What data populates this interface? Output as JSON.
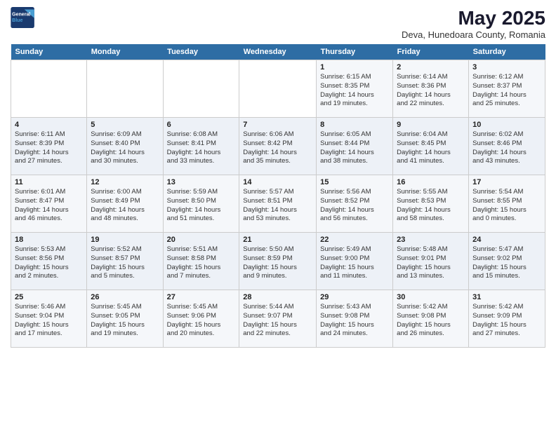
{
  "header": {
    "logo_line1": "General",
    "logo_line2": "Blue",
    "month": "May 2025",
    "location": "Deva, Hunedoara County, Romania"
  },
  "weekdays": [
    "Sunday",
    "Monday",
    "Tuesday",
    "Wednesday",
    "Thursday",
    "Friday",
    "Saturday"
  ],
  "weeks": [
    [
      {
        "day": "",
        "info": ""
      },
      {
        "day": "",
        "info": ""
      },
      {
        "day": "",
        "info": ""
      },
      {
        "day": "",
        "info": ""
      },
      {
        "day": "1",
        "info": "Sunrise: 6:15 AM\nSunset: 8:35 PM\nDaylight: 14 hours\nand 19 minutes."
      },
      {
        "day": "2",
        "info": "Sunrise: 6:14 AM\nSunset: 8:36 PM\nDaylight: 14 hours\nand 22 minutes."
      },
      {
        "day": "3",
        "info": "Sunrise: 6:12 AM\nSunset: 8:37 PM\nDaylight: 14 hours\nand 25 minutes."
      }
    ],
    [
      {
        "day": "4",
        "info": "Sunrise: 6:11 AM\nSunset: 8:39 PM\nDaylight: 14 hours\nand 27 minutes."
      },
      {
        "day": "5",
        "info": "Sunrise: 6:09 AM\nSunset: 8:40 PM\nDaylight: 14 hours\nand 30 minutes."
      },
      {
        "day": "6",
        "info": "Sunrise: 6:08 AM\nSunset: 8:41 PM\nDaylight: 14 hours\nand 33 minutes."
      },
      {
        "day": "7",
        "info": "Sunrise: 6:06 AM\nSunset: 8:42 PM\nDaylight: 14 hours\nand 35 minutes."
      },
      {
        "day": "8",
        "info": "Sunrise: 6:05 AM\nSunset: 8:44 PM\nDaylight: 14 hours\nand 38 minutes."
      },
      {
        "day": "9",
        "info": "Sunrise: 6:04 AM\nSunset: 8:45 PM\nDaylight: 14 hours\nand 41 minutes."
      },
      {
        "day": "10",
        "info": "Sunrise: 6:02 AM\nSunset: 8:46 PM\nDaylight: 14 hours\nand 43 minutes."
      }
    ],
    [
      {
        "day": "11",
        "info": "Sunrise: 6:01 AM\nSunset: 8:47 PM\nDaylight: 14 hours\nand 46 minutes."
      },
      {
        "day": "12",
        "info": "Sunrise: 6:00 AM\nSunset: 8:49 PM\nDaylight: 14 hours\nand 48 minutes."
      },
      {
        "day": "13",
        "info": "Sunrise: 5:59 AM\nSunset: 8:50 PM\nDaylight: 14 hours\nand 51 minutes."
      },
      {
        "day": "14",
        "info": "Sunrise: 5:57 AM\nSunset: 8:51 PM\nDaylight: 14 hours\nand 53 minutes."
      },
      {
        "day": "15",
        "info": "Sunrise: 5:56 AM\nSunset: 8:52 PM\nDaylight: 14 hours\nand 56 minutes."
      },
      {
        "day": "16",
        "info": "Sunrise: 5:55 AM\nSunset: 8:53 PM\nDaylight: 14 hours\nand 58 minutes."
      },
      {
        "day": "17",
        "info": "Sunrise: 5:54 AM\nSunset: 8:55 PM\nDaylight: 15 hours\nand 0 minutes."
      }
    ],
    [
      {
        "day": "18",
        "info": "Sunrise: 5:53 AM\nSunset: 8:56 PM\nDaylight: 15 hours\nand 2 minutes."
      },
      {
        "day": "19",
        "info": "Sunrise: 5:52 AM\nSunset: 8:57 PM\nDaylight: 15 hours\nand 5 minutes."
      },
      {
        "day": "20",
        "info": "Sunrise: 5:51 AM\nSunset: 8:58 PM\nDaylight: 15 hours\nand 7 minutes."
      },
      {
        "day": "21",
        "info": "Sunrise: 5:50 AM\nSunset: 8:59 PM\nDaylight: 15 hours\nand 9 minutes."
      },
      {
        "day": "22",
        "info": "Sunrise: 5:49 AM\nSunset: 9:00 PM\nDaylight: 15 hours\nand 11 minutes."
      },
      {
        "day": "23",
        "info": "Sunrise: 5:48 AM\nSunset: 9:01 PM\nDaylight: 15 hours\nand 13 minutes."
      },
      {
        "day": "24",
        "info": "Sunrise: 5:47 AM\nSunset: 9:02 PM\nDaylight: 15 hours\nand 15 minutes."
      }
    ],
    [
      {
        "day": "25",
        "info": "Sunrise: 5:46 AM\nSunset: 9:04 PM\nDaylight: 15 hours\nand 17 minutes."
      },
      {
        "day": "26",
        "info": "Sunrise: 5:45 AM\nSunset: 9:05 PM\nDaylight: 15 hours\nand 19 minutes."
      },
      {
        "day": "27",
        "info": "Sunrise: 5:45 AM\nSunset: 9:06 PM\nDaylight: 15 hours\nand 20 minutes."
      },
      {
        "day": "28",
        "info": "Sunrise: 5:44 AM\nSunset: 9:07 PM\nDaylight: 15 hours\nand 22 minutes."
      },
      {
        "day": "29",
        "info": "Sunrise: 5:43 AM\nSunset: 9:08 PM\nDaylight: 15 hours\nand 24 minutes."
      },
      {
        "day": "30",
        "info": "Sunrise: 5:42 AM\nSunset: 9:08 PM\nDaylight: 15 hours\nand 26 minutes."
      },
      {
        "day": "31",
        "info": "Sunrise: 5:42 AM\nSunset: 9:09 PM\nDaylight: 15 hours\nand 27 minutes."
      }
    ]
  ]
}
